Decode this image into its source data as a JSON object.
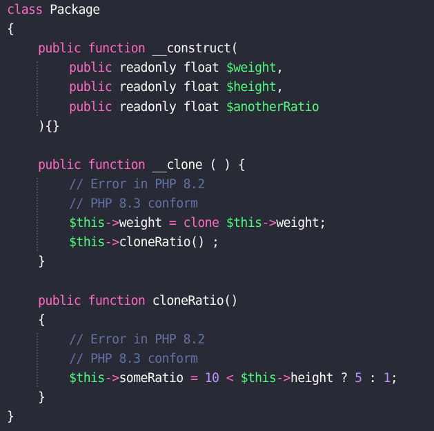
{
  "editor": {
    "language": "php",
    "colors": {
      "background": "#282a36",
      "keyword": "#ff6ac1",
      "variable": "#50fa7b",
      "comment": "#6272a4",
      "number": "#bd93f9",
      "text": "#f8f8f2"
    },
    "lines": [
      {
        "indent": 0,
        "tokens": [
          {
            "t": "kw",
            "v": "class"
          },
          {
            "t": "pl",
            "v": " Package"
          }
        ]
      },
      {
        "indent": 0,
        "tokens": [
          {
            "t": "pl",
            "v": "{"
          }
        ]
      },
      {
        "indent": 1,
        "tokens": [
          {
            "t": "kw",
            "v": "public"
          },
          {
            "t": "pl",
            "v": " "
          },
          {
            "t": "kw",
            "v": "function"
          },
          {
            "t": "pl",
            "v": " __construct("
          }
        ]
      },
      {
        "indent": 2,
        "tokens": [
          {
            "t": "kw",
            "v": "public"
          },
          {
            "t": "pl",
            "v": " readonly float "
          },
          {
            "t": "var",
            "v": "$weight"
          },
          {
            "t": "pl",
            "v": ","
          }
        ]
      },
      {
        "indent": 2,
        "tokens": [
          {
            "t": "kw",
            "v": "public"
          },
          {
            "t": "pl",
            "v": " readonly float "
          },
          {
            "t": "var",
            "v": "$height"
          },
          {
            "t": "pl",
            "v": ","
          }
        ]
      },
      {
        "indent": 2,
        "tokens": [
          {
            "t": "kw",
            "v": "public"
          },
          {
            "t": "pl",
            "v": " readonly float "
          },
          {
            "t": "var",
            "v": "$anotherRatio"
          }
        ]
      },
      {
        "indent": 1,
        "tokens": [
          {
            "t": "pl",
            "v": "){}"
          }
        ]
      },
      {
        "indent": 0,
        "tokens": []
      },
      {
        "indent": 1,
        "tokens": [
          {
            "t": "kw",
            "v": "public"
          },
          {
            "t": "pl",
            "v": " "
          },
          {
            "t": "kw",
            "v": "function"
          },
          {
            "t": "pl",
            "v": " __clone ( ) {"
          }
        ]
      },
      {
        "indent": 2,
        "tokens": [
          {
            "t": "cm",
            "v": "// Error in PHP 8.2"
          }
        ]
      },
      {
        "indent": 2,
        "tokens": [
          {
            "t": "cm",
            "v": "// PHP 8.3 conform"
          }
        ]
      },
      {
        "indent": 2,
        "tokens": [
          {
            "t": "var",
            "v": "$this"
          },
          {
            "t": "op",
            "v": "->"
          },
          {
            "t": "pl",
            "v": "weight "
          },
          {
            "t": "op",
            "v": "="
          },
          {
            "t": "pl",
            "v": " "
          },
          {
            "t": "kw",
            "v": "clone"
          },
          {
            "t": "pl",
            "v": " "
          },
          {
            "t": "var",
            "v": "$this"
          },
          {
            "t": "op",
            "v": "->"
          },
          {
            "t": "pl",
            "v": "weight;"
          }
        ]
      },
      {
        "indent": 2,
        "tokens": [
          {
            "t": "var",
            "v": "$this"
          },
          {
            "t": "op",
            "v": "->"
          },
          {
            "t": "pl",
            "v": "cloneRatio() ;"
          }
        ]
      },
      {
        "indent": 1,
        "tokens": [
          {
            "t": "pl",
            "v": "}"
          }
        ]
      },
      {
        "indent": 0,
        "tokens": []
      },
      {
        "indent": 1,
        "tokens": [
          {
            "t": "kw",
            "v": "public"
          },
          {
            "t": "pl",
            "v": " "
          },
          {
            "t": "kw",
            "v": "function"
          },
          {
            "t": "pl",
            "v": " cloneRatio()"
          }
        ]
      },
      {
        "indent": 1,
        "tokens": [
          {
            "t": "pl",
            "v": "{"
          }
        ]
      },
      {
        "indent": 2,
        "tokens": [
          {
            "t": "cm",
            "v": "// Error in PHP 8.2"
          }
        ]
      },
      {
        "indent": 2,
        "tokens": [
          {
            "t": "cm",
            "v": "// PHP 8.3 conform"
          }
        ]
      },
      {
        "indent": 2,
        "tokens": [
          {
            "t": "var",
            "v": "$this"
          },
          {
            "t": "op",
            "v": "->"
          },
          {
            "t": "pl",
            "v": "someRatio "
          },
          {
            "t": "op",
            "v": "="
          },
          {
            "t": "pl",
            "v": " "
          },
          {
            "t": "num",
            "v": "10"
          },
          {
            "t": "pl",
            "v": " "
          },
          {
            "t": "op",
            "v": "<"
          },
          {
            "t": "pl",
            "v": " "
          },
          {
            "t": "var",
            "v": "$this"
          },
          {
            "t": "op",
            "v": "->"
          },
          {
            "t": "pl",
            "v": "height ? "
          },
          {
            "t": "num",
            "v": "5"
          },
          {
            "t": "pl",
            "v": " : "
          },
          {
            "t": "num",
            "v": "1"
          },
          {
            "t": "pl",
            "v": ";"
          }
        ]
      },
      {
        "indent": 1,
        "tokens": [
          {
            "t": "pl",
            "v": "}"
          }
        ]
      },
      {
        "indent": 0,
        "tokens": [
          {
            "t": "pl",
            "v": "}"
          }
        ]
      }
    ]
  }
}
